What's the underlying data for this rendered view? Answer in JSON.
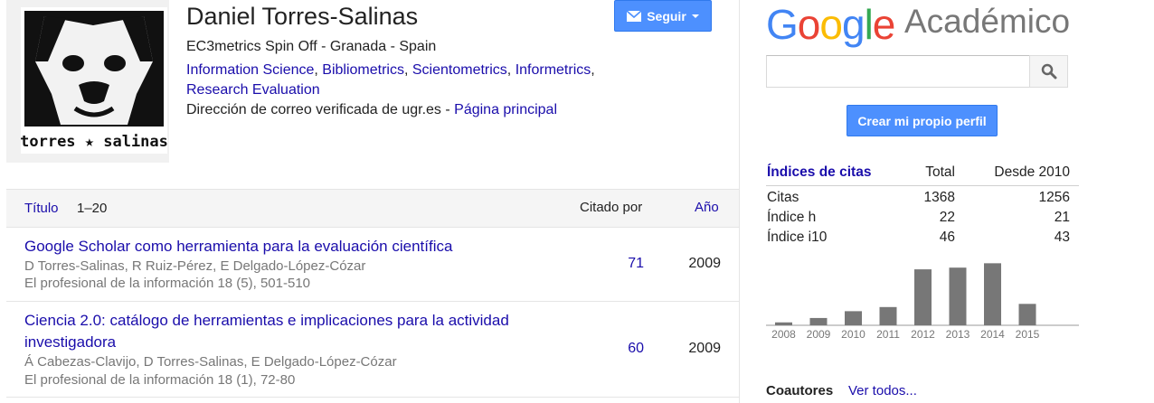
{
  "profile": {
    "name": "Daniel Torres-Salinas",
    "affiliation": "EC3metrics Spin Off - Granada - Spain",
    "interests": [
      "Information Science",
      "Bibliometrics",
      "Scientometrics",
      "Informetrics",
      "Research Evaluation"
    ],
    "email_text": "Dirección de correo verificada de ugr.es - ",
    "homepage_label": "Página principal",
    "photo_caption": "torres ★ salinas",
    "follow_label": "Seguir"
  },
  "table": {
    "header_title": "Título",
    "header_range": "1–20",
    "header_cited": "Citado por",
    "header_year": "Año",
    "rows": [
      {
        "title": "Google Scholar como herramienta para la evaluación científica",
        "authors": "D Torres-Salinas, R Ruiz-Pérez, E Delgado-López-Cózar",
        "venue": "El profesional de la información 18 (5), 501-510",
        "cited": "71",
        "year": "2009"
      },
      {
        "title": "Ciencia 2.0: catálogo de herramientas e implicaciones para la actividad investigadora",
        "authors": "Á Cabezas-Clavijo, D Torres-Salinas, E Delgado-López-Cózar",
        "venue": "El profesional de la información 18 (1), 72-80",
        "cited": "60",
        "year": "2009"
      }
    ]
  },
  "sidebar": {
    "logo_google": "Google",
    "logo_suffix": "Académico",
    "logo_colors": [
      "#4285f4",
      "#ea4335",
      "#fbbc05",
      "#4285f4",
      "#34a853",
      "#ea4335"
    ],
    "search_value": "",
    "search_icon": "magnifier-icon",
    "create_profile_label": "Crear mi propio perfil",
    "citations": {
      "title": "Índices de citas",
      "col_total": "Total",
      "col_since": "Desde 2010",
      "rows": [
        {
          "label": "Citas",
          "total": "1368",
          "since": "1256"
        },
        {
          "label": "Índice h",
          "total": "22",
          "since": "21"
        },
        {
          "label": "Índice i10",
          "total": "46",
          "since": "43"
        }
      ]
    },
    "coauthors_label": "Coautores",
    "coauthors_link": "Ver todos..."
  },
  "chart_data": {
    "type": "bar",
    "categories": [
      "2008",
      "2009",
      "2010",
      "2011",
      "2012",
      "2013",
      "2014",
      "2015"
    ],
    "values": [
      12,
      30,
      58,
      75,
      230,
      237,
      255,
      88
    ],
    "bar_color": "#777777",
    "ylim": [
      0,
      260
    ]
  }
}
